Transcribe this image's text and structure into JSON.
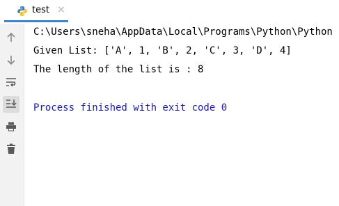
{
  "tab": {
    "label": "test",
    "close_glyph": "×",
    "icon": "python-icon"
  },
  "toolbar": {
    "tools": [
      {
        "name": "up-arrow-icon",
        "active": false
      },
      {
        "name": "down-arrow-icon",
        "active": false
      },
      {
        "name": "soft-wrap-icon",
        "active": false
      },
      {
        "name": "scroll-to-end-icon",
        "active": true
      },
      {
        "name": "print-icon",
        "active": false
      },
      {
        "name": "trash-icon",
        "active": false
      }
    ]
  },
  "console": {
    "command_line": "C:\\Users\\sneha\\AppData\\Local\\Programs\\Python\\Python",
    "output_line_1": "Given List: ['A', 1, 'B', 2, 'C', 3, 'D', 4]",
    "output_line_2": "The length of the list is : 8",
    "exit_line": "Process finished with exit code 0"
  },
  "colors": {
    "exit_text": "#1a1aa6",
    "tab_underline": "#4083c9",
    "toolbar_bg": "#f2f2f2",
    "icon_gray": "#8a8a8a"
  }
}
